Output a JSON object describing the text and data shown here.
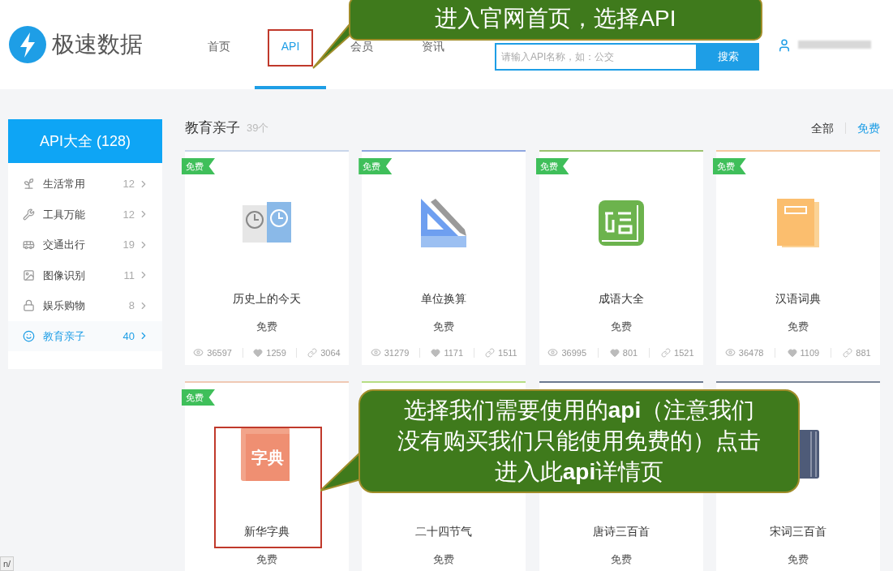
{
  "logo": {
    "text": "极速数据"
  },
  "nav": [
    {
      "label": "首页",
      "selected": false
    },
    {
      "label": "API",
      "selected": true
    },
    {
      "label": "会员",
      "selected": false
    },
    {
      "label": "资讯",
      "selected": false
    }
  ],
  "search": {
    "placeholder": "请输入API名称，如：公交",
    "button": "搜索"
  },
  "sidebar": {
    "title": "API大全 (128)",
    "items": [
      {
        "label": "生活常用",
        "count": "12",
        "selected": false
      },
      {
        "label": "工具万能",
        "count": "12",
        "selected": false
      },
      {
        "label": "交通出行",
        "count": "19",
        "selected": false
      },
      {
        "label": "图像识别",
        "count": "11",
        "selected": false
      },
      {
        "label": "娱乐购物",
        "count": "8",
        "selected": false
      },
      {
        "label": "教育亲子",
        "count": "40",
        "selected": true
      }
    ]
  },
  "section": {
    "title": "教育亲子",
    "count": "39个",
    "filters": [
      {
        "label": "全部",
        "selected": false
      },
      {
        "label": "免费",
        "selected": true
      }
    ]
  },
  "cards": [
    {
      "name": "历史上的今天",
      "price": "免费",
      "tag": "免费",
      "views": "36597",
      "likes": "1259",
      "links": "3064",
      "color": "#c9d6ea"
    },
    {
      "name": "单位换算",
      "price": "免费",
      "tag": "免费",
      "views": "31279",
      "likes": "1171",
      "links": "1511",
      "color": "#8fa6e0"
    },
    {
      "name": "成语大全",
      "price": "免费",
      "tag": "免费",
      "views": "36995",
      "likes": "801",
      "links": "1521",
      "color": "#9cc26f"
    },
    {
      "name": "汉语词典",
      "price": "免费",
      "tag": "免费",
      "views": "36478",
      "likes": "1109",
      "links": "881",
      "color": "#f5c9a0"
    },
    {
      "name": "新华字典",
      "price": "免费",
      "tag": "免费",
      "icon_text": "字典",
      "color": "#f0c9b4"
    },
    {
      "name": "二十四节气",
      "price": "免费",
      "color": "#b6dd84"
    },
    {
      "name": "唐诗三百首",
      "price": "免费",
      "color": "#6c7a90"
    },
    {
      "name": "宋词三百首",
      "price": "免费",
      "color": "#7c8799"
    }
  ],
  "annotations": [
    {
      "text": "进入官网首页，选择API"
    },
    {
      "text": "选择我们需要使用的**api**（注意我们没有购买我们只能使用免费的）点击进入此**api**详情页"
    }
  ],
  "status_url": "n/"
}
